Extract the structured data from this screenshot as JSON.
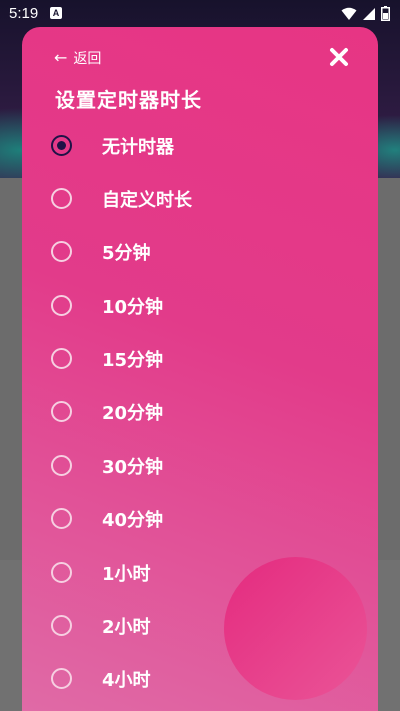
{
  "status_bar": {
    "time": "5:19",
    "notification_badge": "A",
    "icons": [
      "wifi-icon",
      "signal-icon",
      "battery-icon"
    ]
  },
  "dialog": {
    "back_label": "返回",
    "title": "设置定时器时长",
    "options": [
      {
        "label": "无计时器",
        "selected": true
      },
      {
        "label": "自定义时长",
        "selected": false
      },
      {
        "label": "5分钟",
        "selected": false
      },
      {
        "label": "10分钟",
        "selected": false
      },
      {
        "label": "15分钟",
        "selected": false
      },
      {
        "label": "20分钟",
        "selected": false
      },
      {
        "label": "30分钟",
        "selected": false
      },
      {
        "label": "40分钟",
        "selected": false
      },
      {
        "label": "1小时",
        "selected": false
      },
      {
        "label": "2小时",
        "selected": false
      },
      {
        "label": "4小时",
        "selected": false
      }
    ]
  },
  "colors": {
    "dialog_gradient_start": "#e73584",
    "dialog_gradient_end": "#e06aa6",
    "radio_selected": "#1f1247",
    "radio_unselected": "#f6cfe1",
    "text": "#ffffff"
  }
}
